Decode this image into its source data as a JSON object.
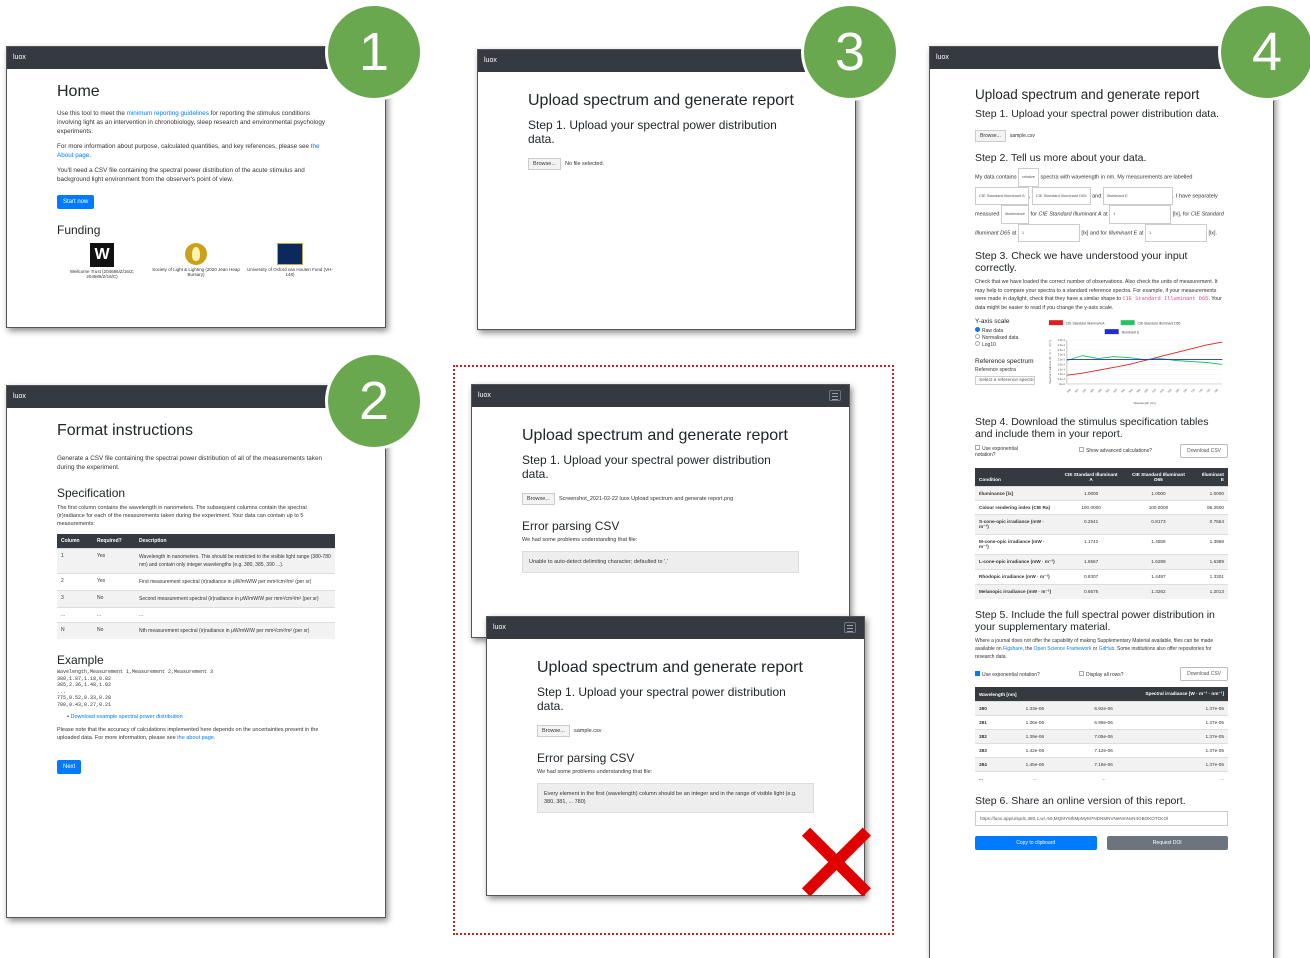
{
  "badges": {
    "b1": "1",
    "b2": "2",
    "b3": "3",
    "b4": "4"
  },
  "brand": "luox",
  "home": {
    "title": "Home",
    "p1_pre": "Use this tool to meet the ",
    "p1_link": "minimum reporting guidelines",
    "p1_post": " for reporting the stimulus conditions involving light as an intervention in chronobiology, sleep research and environmental psychology experiments.",
    "p2_pre": "For more information about purpose, calculated quantities, and key references, please see ",
    "p2_link": "the About page",
    "p2_post": ".",
    "p3": "You'll need a CSV file containing the spectral power distribution of the acute stimulus and background light environment from the observer's point of view.",
    "start": "Start now",
    "funding": "Funding",
    "funders": [
      {
        "name": "Wellcome Trust (204686/Z/16/Z, 204686/Z/16/C)",
        "logo": "W"
      },
      {
        "name": "Society of Light & Lighting (2020 Jean Heap Bursary)",
        "logo": "sll"
      },
      {
        "name": "University of Oxford van Houten Fund (VH-148)",
        "logo": "oxford"
      }
    ]
  },
  "format": {
    "title": "Format instructions",
    "intro": "Generate a CSV file containing the spectral power distribution of all of the measurements taken during the experiment.",
    "spec_title": "Specification",
    "spec_text": "The first column contains the wavelength in nanometers. The subsequent columns contain the spectral (ir)radiance for each of the measurements taken during the experiment. Your data can contain up to 5 measurements:",
    "headers": [
      "Column",
      "Required?",
      "Description"
    ],
    "rows": [
      [
        "1",
        "Yes",
        "Wavelength in nanometers. This should be restricted to the visible light range (380-780 nm) and contain only integer wavelengths (e.g. 380, 385, 390 ...)."
      ],
      [
        "2",
        "Yes",
        "First measurement spectral (ir)radiance in μW/mW/W per mm²/cm²/m² (per sr)"
      ],
      [
        "3",
        "No",
        "Second measurement spectral (ir)radiance in μW/mW/W per mm²/cm²/m² (per sr)"
      ],
      [
        "...",
        "...",
        "..."
      ],
      [
        "N",
        "No",
        "Nth measurement spectral (ir)radiance in μW/mW/W per mm²/cm²/m² (per sr)"
      ]
    ],
    "example_title": "Example",
    "example_lines": [
      "Wavelength,Measurement 1,Measurement 2,Measurement 3",
      "380,1.87,1.18,0.82",
      "385,2.36,1.48,1.02",
      "...",
      "775,0.52,0.33,0.28",
      "780,0.43,0.27,0.21"
    ],
    "download": "Download example spectral power distribution",
    "note_pre": "Please note that the accuracy of calculations implemented here depends on the uncertainties present in the uploaded data. For more information, please see ",
    "note_link": "the about page",
    "note_post": ".",
    "next": "Next"
  },
  "upload": {
    "title": "Upload spectrum and generate report",
    "step1": "Step 1. Upload your spectral power distribution data.",
    "browse": "Browse...",
    "nofile": "No file selected."
  },
  "err1": {
    "file": "Screenshot_2021-02-22 luox Upload spectrum and generate report.png",
    "title": "Error parsing CSV",
    "sub": "We had some problems understanding that file:",
    "msg": "Unable to auto-detect delimiting character; defaulted to ','"
  },
  "err2": {
    "file": "sample.csv",
    "title": "Error parsing CSV",
    "sub": "We had some problems understanding that file:",
    "msg": "Every element in the first (wavelength) column should be an integer and in the range of visible light (e.g. 380, 381, ... 780)",
    "cross": "✕"
  },
  "report": {
    "file": "sample.csv",
    "step2": "Step 2. Tell us more about your data.",
    "s2_a": "My data contains",
    "s2_sel1": "relative",
    "s2_b": "spectra with wavelength in nm. My measurements are labelled",
    "s2_l1": "CIE Standard Illuminant A",
    "s2_l2": "CIE Standard Illuminant D65",
    "s2_and": "and",
    "s2_l3": "Illuminant E",
    "s2_c": ". I have separately measured",
    "s2_sel2": "illuminance",
    "s2_for": "for",
    "s2_n1": "CIE Standard Illuminant A",
    "s2_at": "at",
    "s2_v1": "1",
    "s2_lx1": "[lx], for",
    "s2_n2": "CIE Standard Illuminant D65",
    "s2_v2": "1",
    "s2_lx2": "[lx] and for",
    "s2_n3": "Illuminant E",
    "s2_v3": "1",
    "s2_lx3": "[lx].",
    "step3": "Step 3. Check we have understood your input correctly.",
    "s3_text_pre": "Check that we have loaded the correct number of observations. Also check the units of measurement. It may help to compare your spectra to a standard reference spectra. For example, if your measurements were made in daylight, check that they have a similar shape to ",
    "s3_code": "CIE Standard Illuminant D65",
    "s3_text_post": ". Your data might be easier to read if you change the y-axis scale.",
    "yscale": "Y-axis scale",
    "yopts": [
      "Raw data",
      "Normalised data",
      "Log10"
    ],
    "refspec": "Reference spectrum",
    "refspec_label": "Reference spectra",
    "refspec_sel": "Select a reference spectrum",
    "chart_data": {
      "type": "line",
      "title": "",
      "xlabel": "Wavelength [nm]",
      "ylabel": "Spectral irradiance [W · m⁻² · nm⁻¹]",
      "series": [
        {
          "name": "CIE Standard Illuminant A",
          "color": "#e02020",
          "values": [
            0.9,
            1.1,
            1.4,
            1.7,
            2.0,
            2.4,
            2.8,
            3.2,
            3.6,
            4.0,
            4.3
          ]
        },
        {
          "name": "CIE Standard Illuminant D65",
          "color": "#22c55e",
          "values": [
            2.4,
            2.9,
            2.6,
            2.8,
            2.7,
            2.5,
            2.6,
            2.4,
            2.3,
            2.2,
            2.0
          ]
        },
        {
          "name": "Illuminant E",
          "color": "#1f2fd0",
          "values": [
            2.5,
            2.5,
            2.5,
            2.5,
            2.5,
            2.5,
            2.5,
            2.5,
            2.5,
            2.5,
            2.5
          ]
        }
      ],
      "yticks": [
        "4.5e-3",
        "4.0e-3",
        "3.5e-3",
        "3.0e-3",
        "2.5e-3",
        "2.0e-3",
        "1.5e-3",
        "1.0e-3",
        "5.0e-4",
        "0e+0"
      ],
      "xticks": [
        "400",
        "420",
        "440",
        "460",
        "480",
        "500",
        "520",
        "540",
        "560",
        "580",
        "600",
        "620",
        "640",
        "660",
        "680",
        "700",
        "720",
        "740",
        "760",
        "780"
      ]
    },
    "step4": "Step 4. Download the stimulus specification tables and include them in your report.",
    "exp_notation": "Use exponential notation?",
    "show_adv": "Show advanced calculations?",
    "download_csv": "Download CSV",
    "t4_headers": [
      "Condition",
      "CIE Standard Illuminant A",
      "CIE Standard Illuminant D65",
      "Illuminant E"
    ],
    "t4_rows": [
      [
        "Illuminance [lx]",
        "1.0000",
        "1.0000",
        "1.0000"
      ],
      [
        "Colour rendering index (CIE Ra)",
        "100.0000",
        "100.0000",
        "95.2500"
      ],
      [
        "S-cone-opic irradiance (mW · m⁻²)",
        "0.2541",
        "0.8173",
        "0.7564"
      ],
      [
        "M-cone-opic irradiance (mW · m⁻²)",
        "1.1742",
        "1.4558",
        "1.3968"
      ],
      [
        "L-cone-opic irradiance (mW · m⁻²)",
        "1.6567",
        "1.6289",
        "1.6389"
      ],
      [
        "Rhodopic irradiance (mW · m⁻²)",
        "0.8307",
        "1.4497",
        "1.3301"
      ],
      [
        "Melanopic irradiance (mW · m⁻²)",
        "0.6575",
        "1.3262",
        "1.2013"
      ]
    ],
    "step5": "Step 5. Include the full spectral power distribution in your supplementary material.",
    "s5_pre": "Where a journal does not offer the capability of making Supplementary Material available, files can be made available on ",
    "s5_l1": "Figshare",
    "s5_mid1": ", the ",
    "s5_l2": "Open Science Framework",
    "s5_mid2": " or ",
    "s5_l3": "GitHub",
    "s5_post": ". Some institutions also offer repositories for research data.",
    "display_all": "Display all rows?",
    "t5_headers": [
      "Wavelength [nm]",
      "Spectral irradiance [W · m⁻² · nm⁻¹]"
    ],
    "t5_rows": [
      [
        "380",
        "1.33e-06",
        "6.92e-06",
        "1.37e-05"
      ],
      [
        "381",
        "1.36e-06",
        "6.99e-06",
        "1.37e-05"
      ],
      [
        "382",
        "1.39e-06",
        "7.05e-06",
        "1.37e-05"
      ],
      [
        "383",
        "1.42e-06",
        "7.12e-06",
        "1.37e-05"
      ],
      [
        "384",
        "1.45e-06",
        "7.18e-06",
        "1.37e-05"
      ],
      [
        "...",
        "...",
        "...",
        "..."
      ]
    ],
    "step6": "Step 6. Share an online version of this report.",
    "url": "https://luox.app/u/spd1,380,1,wl,-59,MQMYMhMpMyM7NDNMNVNeNmNvN4OBOKOTOcOl",
    "copy": "Copy to clipboard",
    "doi": "Request DOI"
  }
}
